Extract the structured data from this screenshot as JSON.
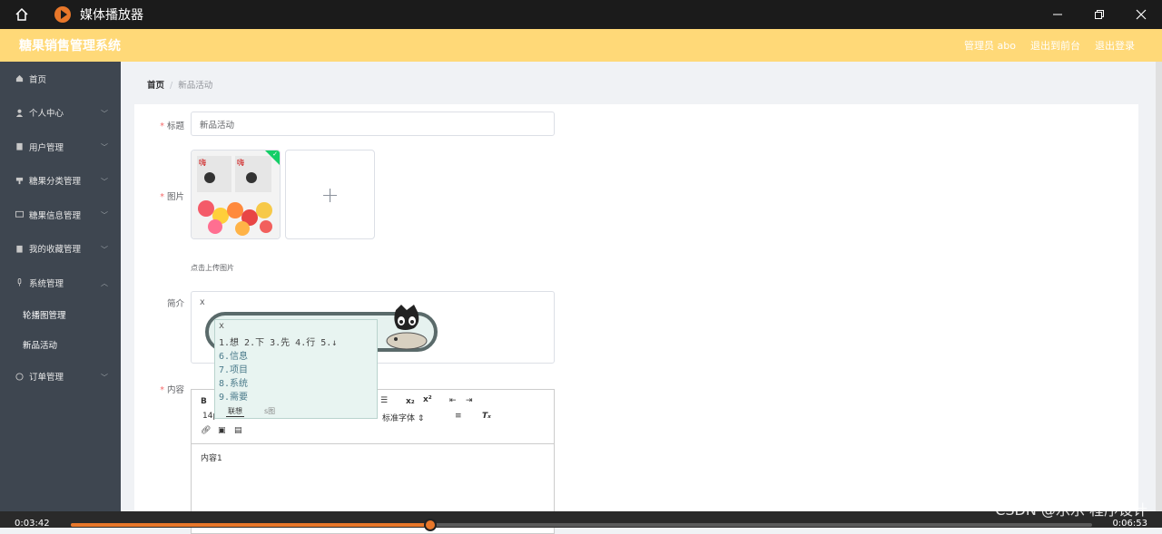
{
  "player": {
    "title": "媒体播放器",
    "time_current": "0:03:42",
    "time_total": "0:06:53",
    "progress": 0.352
  },
  "app": {
    "brand": "糖果销售管理系统",
    "admin_label": "管理员 abo",
    "back_label": "退出到前台",
    "logout_label": "退出登录",
    "accent": "#ffd978"
  },
  "sidebar": {
    "items": [
      {
        "label": "首页",
        "icon": "home-icon"
      },
      {
        "label": "个人中心",
        "icon": "user-icon"
      },
      {
        "label": "用户管理",
        "icon": "clipboard-icon"
      },
      {
        "label": "糖果分类管理",
        "icon": "category-icon"
      },
      {
        "label": "糖果信息管理",
        "icon": "chat-icon"
      },
      {
        "label": "我的收藏管理",
        "icon": "clipboard-icon"
      },
      {
        "label": "系统管理",
        "icon": "mic-icon"
      }
    ],
    "sub_items": [
      "轮播图管理",
      "新品活动"
    ],
    "last_item": {
      "label": "订单管理",
      "icon": "order-icon"
    }
  },
  "breadcrumb": {
    "home": "首页",
    "current": "新品活动"
  },
  "form": {
    "title_label": "标题",
    "title_value": "新品活动",
    "image_label": "图片",
    "upload_hint": "点击上传图片",
    "intro_label": "简介",
    "intro_value": "x",
    "content_label": "内容",
    "content_value": "内容1"
  },
  "editor_toolbar": {
    "font_size": "14p",
    "font_family": "标准字体"
  },
  "ime": {
    "input": "x",
    "row1": "1.想 2.下 3.先 4.行 5.↓",
    "candidates": [
      "6.信息",
      "7.项目",
      "8.系统",
      "9.需要"
    ],
    "tab1": "联想",
    "tab2": "s图"
  },
  "watermark": "CSDN @乐乐 程序设计"
}
